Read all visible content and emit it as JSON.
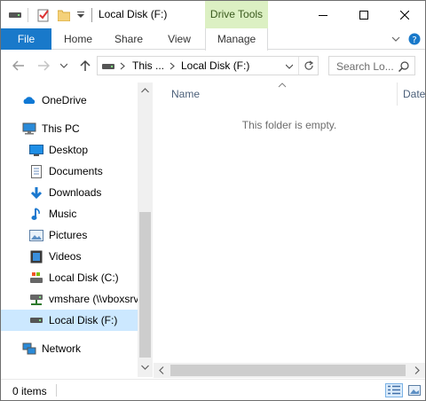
{
  "window": {
    "title": "Local Disk (F:)",
    "context_tab": "Drive Tools",
    "accent": "#1979ca",
    "context_color": "#dcf0c3"
  },
  "ribbon": {
    "tabs": [
      {
        "label": "File"
      },
      {
        "label": "Home"
      },
      {
        "label": "Share"
      },
      {
        "label": "View"
      },
      {
        "label": "Manage"
      }
    ]
  },
  "address": {
    "crumbs": [
      "This ...",
      "Local Disk (F:)"
    ]
  },
  "search": {
    "placeholder": "Search Lo..."
  },
  "nav_pane": {
    "items": [
      {
        "label": "OneDrive",
        "icon": "onedrive-icon"
      },
      {
        "label": "This PC",
        "icon": "computer-icon"
      },
      {
        "label": "Desktop",
        "icon": "desktop-icon"
      },
      {
        "label": "Documents",
        "icon": "documents-icon"
      },
      {
        "label": "Downloads",
        "icon": "downloads-icon"
      },
      {
        "label": "Music",
        "icon": "music-icon"
      },
      {
        "label": "Pictures",
        "icon": "pictures-icon"
      },
      {
        "label": "Videos",
        "icon": "videos-icon"
      },
      {
        "label": "Local Disk (C:)",
        "icon": "drive-icon"
      },
      {
        "label": "vmshare (\\\\vboxsrv",
        "icon": "network-drive-icon"
      },
      {
        "label": "Local Disk (F:)",
        "icon": "drive-icon",
        "selected": true
      },
      {
        "label": "Network",
        "icon": "network-icon"
      }
    ]
  },
  "content": {
    "columns": [
      "Name",
      "Date"
    ],
    "empty_message": "This folder is empty."
  },
  "status": {
    "item_count": "0 items"
  }
}
